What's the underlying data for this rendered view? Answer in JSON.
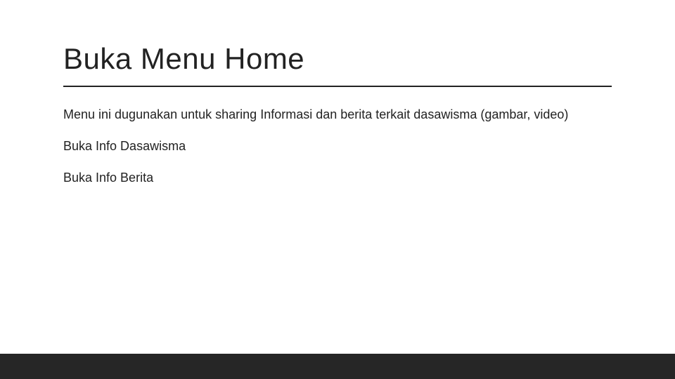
{
  "slide": {
    "title": "Buka Menu Home",
    "lines": [
      "Menu ini dugunakan untuk sharing Informasi dan berita terkait dasawisma (gambar, video)",
      "Buka Info Dasawisma",
      "Buka Info Berita"
    ]
  }
}
